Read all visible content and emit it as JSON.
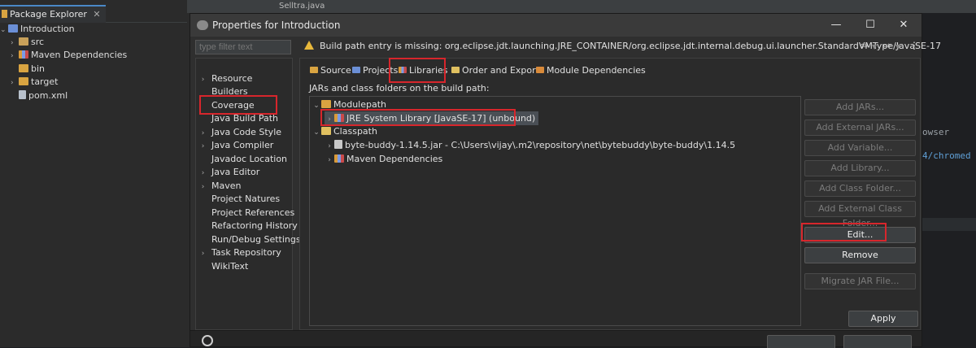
{
  "ide": {
    "package_explorer_tab": "Package Explorer",
    "tree": [
      {
        "label": "Introduction",
        "expander": "⌄",
        "icon": "project-icon"
      },
      {
        "label": "src",
        "expander": "›",
        "icon": "package-folder-icon"
      },
      {
        "label": "Maven Dependencies",
        "expander": "›",
        "icon": "library-icon"
      },
      {
        "label": "bin",
        "expander": "",
        "icon": "folder-icon"
      },
      {
        "label": "target",
        "expander": "›",
        "icon": "folder-icon"
      },
      {
        "label": "pom.xml",
        "expander": "",
        "icon": "xml-file-icon"
      }
    ],
    "editor_tab": "Selltra.java",
    "code_lines": [
      "owser",
      "4/chromed"
    ]
  },
  "dialog": {
    "title": "Properties for Introduction",
    "minimize": "—",
    "maximize": "☐",
    "close": "✕",
    "filter_placeholder": "type filter text",
    "warning": "Build path entry is missing: org.eclipse.jdt.launching.JRE_CONTAINER/org.eclipse.jdt.internal.debug.ui.launcher.StandardVMType/JavaSE-17",
    "nav_back": "⇦",
    "nav_forward": "⇨",
    "menu": "⋮",
    "nav_items": [
      {
        "label": "Resource",
        "expander": "›"
      },
      {
        "label": "Builders",
        "expander": ""
      },
      {
        "label": "Coverage",
        "expander": ""
      },
      {
        "label": "Java Build Path",
        "expander": ""
      },
      {
        "label": "Java Code Style",
        "expander": "›"
      },
      {
        "label": "Java Compiler",
        "expander": "›"
      },
      {
        "label": "Javadoc Location",
        "expander": ""
      },
      {
        "label": "Java Editor",
        "expander": "›"
      },
      {
        "label": "Maven",
        "expander": "›"
      },
      {
        "label": "Project Natures",
        "expander": ""
      },
      {
        "label": "Project References",
        "expander": ""
      },
      {
        "label": "Refactoring History",
        "expander": ""
      },
      {
        "label": "Run/Debug Settings",
        "expander": ""
      },
      {
        "label": "Task Repository",
        "expander": "›"
      },
      {
        "label": "WikiText",
        "expander": ""
      }
    ],
    "tabs": [
      "Source",
      "Projects",
      "Libraries",
      "Order and Export",
      "Module Dependencies"
    ],
    "build_path_label": "JARs and class folders on the build path:",
    "tree": [
      {
        "label": "Modulepath",
        "expander": "⌄",
        "icon": "modulepath-icon"
      },
      {
        "label": "JRE System Library [JavaSE-17] (unbound)",
        "expander": "›",
        "icon": "jre-library-icon"
      },
      {
        "label": "Classpath",
        "expander": "⌄",
        "icon": "classpath-icon"
      },
      {
        "label": "byte-buddy-1.14.5.jar - C:\\Users\\vijay\\.m2\\repository\\net\\bytebuddy\\byte-buddy\\1.14.5",
        "expander": "›",
        "icon": "jar-icon"
      },
      {
        "label": "Maven Dependencies",
        "expander": "›",
        "icon": "library-icon"
      }
    ],
    "buttons": {
      "add_jars": "Add JARs...",
      "add_external_jars": "Add External JARs...",
      "add_variable": "Add Variable...",
      "add_library": "Add Library...",
      "add_class_folder": "Add Class Folder...",
      "add_external_class_folder": "Add External Class Folder...",
      "edit": "Edit...",
      "remove": "Remove",
      "migrate_jar": "Migrate JAR File..."
    },
    "apply": "Apply"
  },
  "colors": {
    "highlight_red": "#d7262c",
    "warning_yellow": "#e8b83b",
    "selection": "#4a4f55"
  }
}
